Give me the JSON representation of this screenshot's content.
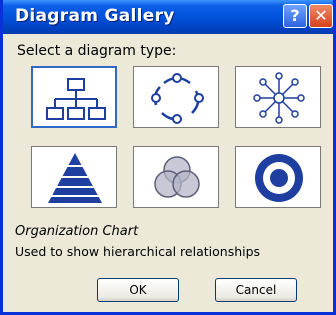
{
  "window": {
    "title": "Diagram Gallery"
  },
  "titlebar": {
    "help_glyph": "?",
    "close_glyph": "✕"
  },
  "prompt": "Select a diagram type:",
  "diagrams": [
    {
      "name": "Organization Chart",
      "icon": "org-chart-icon",
      "selected": true
    },
    {
      "name": "Cycle Diagram",
      "icon": "cycle-icon"
    },
    {
      "name": "Radial Diagram",
      "icon": "radial-icon"
    },
    {
      "name": "Pyramid Diagram",
      "icon": "pyramid-icon"
    },
    {
      "name": "Venn Diagram",
      "icon": "venn-icon"
    },
    {
      "name": "Target Diagram",
      "icon": "target-icon"
    }
  ],
  "description": {
    "title": "Organization Chart",
    "text": "Used to show hierarchical relationships"
  },
  "buttons": {
    "ok": "OK",
    "cancel": "Cancel"
  },
  "colors": {
    "accent": "#0831d9",
    "icon_blue": "#1e3ea0",
    "dialog_bg": "#ece9d8"
  }
}
